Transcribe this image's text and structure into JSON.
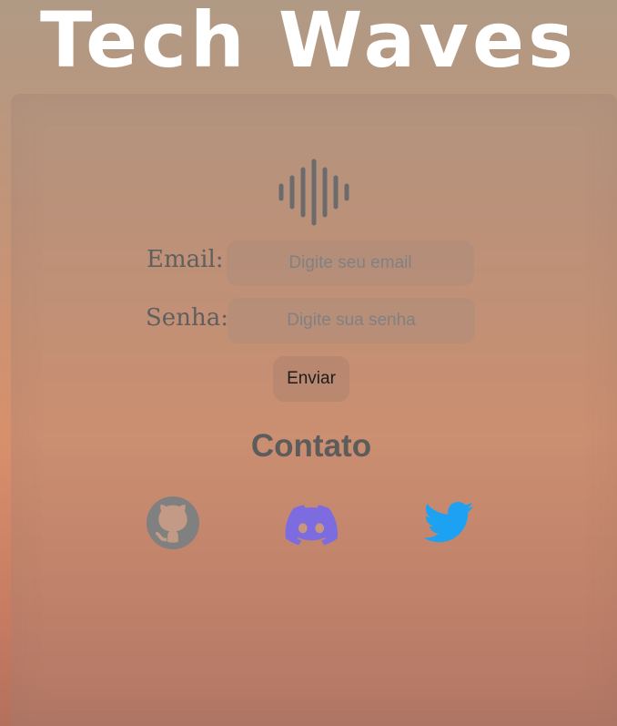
{
  "header": {
    "title": "Tech Waves"
  },
  "logo": {
    "icon": "sound-wave-icon",
    "color": "#6b6b6b"
  },
  "form": {
    "email_label": "Email:",
    "email_placeholder": "Digite seu email",
    "email_value": "",
    "password_label": "Senha:",
    "password_placeholder": "Digite sua senha",
    "password_value": "",
    "submit_label": "Enviar"
  },
  "contact": {
    "title": "Contato",
    "links": [
      {
        "icon": "github-icon",
        "color": "#808080"
      },
      {
        "icon": "discord-icon",
        "color": "#7d6ce0"
      },
      {
        "icon": "twitter-icon",
        "color": "#1da1f2"
      }
    ]
  }
}
